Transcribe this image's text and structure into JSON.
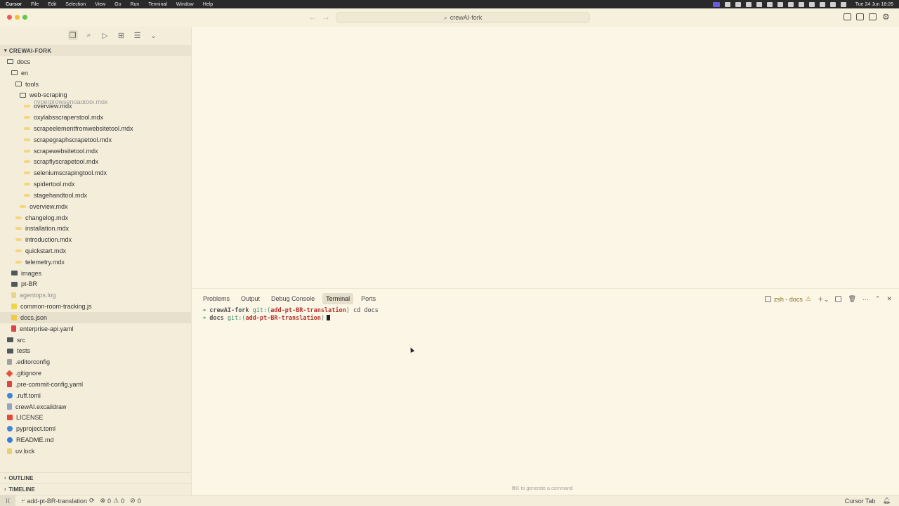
{
  "menubar": {
    "app_name": "Cursor",
    "items": [
      "File",
      "Edit",
      "Selection",
      "View",
      "Go",
      "Run",
      "Terminal",
      "Window",
      "Help"
    ],
    "clock": "Tue 24 Jun  18:26"
  },
  "titlebar": {
    "search_text": "crewAI-fork"
  },
  "sidebar": {
    "explorer_title": "CREWAI-FORK",
    "clipped_entry": "hyperbrowserloadtool.mdx",
    "tree": [
      {
        "label": "docs",
        "icon": "folder-open",
        "indent": 0
      },
      {
        "label": "en",
        "icon": "folder-open",
        "indent": 1
      },
      {
        "label": "tools",
        "icon": "folder-open",
        "indent": 2
      },
      {
        "label": "web-scraping",
        "icon": "folder-open",
        "indent": 3
      },
      {
        "label": "overview.mdx",
        "icon": "mdx",
        "indent": 4
      },
      {
        "label": "oxylabsscraperstool.mdx",
        "icon": "mdx",
        "indent": 4
      },
      {
        "label": "scrapeelementfromwebsitetool.mdx",
        "icon": "mdx",
        "indent": 4
      },
      {
        "label": "scrapegraphscrapetool.mdx",
        "icon": "mdx",
        "indent": 4
      },
      {
        "label": "scrapewebsitetool.mdx",
        "icon": "mdx",
        "indent": 4
      },
      {
        "label": "scrapflyscrapetool.mdx",
        "icon": "mdx",
        "indent": 4
      },
      {
        "label": "seleniumscrapingtool.mdx",
        "icon": "mdx",
        "indent": 4
      },
      {
        "label": "spidertool.mdx",
        "icon": "mdx",
        "indent": 4
      },
      {
        "label": "stagehandtool.mdx",
        "icon": "mdx",
        "indent": 4
      },
      {
        "label": "overview.mdx",
        "icon": "mdx",
        "indent": 3
      },
      {
        "label": "changelog.mdx",
        "icon": "mdx",
        "indent": 2
      },
      {
        "label": "installation.mdx",
        "icon": "mdx",
        "indent": 2
      },
      {
        "label": "introduction.mdx",
        "icon": "mdx",
        "indent": 2
      },
      {
        "label": "quickstart.mdx",
        "icon": "mdx",
        "indent": 2
      },
      {
        "label": "telemetry.mdx",
        "icon": "mdx",
        "indent": 2
      },
      {
        "label": "images",
        "icon": "folder",
        "indent": 1
      },
      {
        "label": "pt-BR",
        "icon": "folder",
        "indent": 1
      },
      {
        "label": "agentops.log",
        "icon": "log",
        "indent": 1,
        "dim": true
      },
      {
        "label": "common-room-tracking.js",
        "icon": "js",
        "indent": 1
      },
      {
        "label": "docs.json",
        "icon": "json",
        "indent": 1,
        "selected": true
      },
      {
        "label": "enterprise-api.yaml",
        "icon": "yaml",
        "indent": 1
      },
      {
        "label": "src",
        "icon": "folder",
        "indent": 0
      },
      {
        "label": "tests",
        "icon": "folder",
        "indent": 0
      },
      {
        "label": ".editorconfig",
        "icon": "editorcfg",
        "indent": 0
      },
      {
        "label": ".gitignore",
        "icon": "git",
        "indent": 0
      },
      {
        "label": ".pre-commit-config.yaml",
        "icon": "yaml",
        "indent": 0
      },
      {
        "label": ".ruff.toml",
        "icon": "gear",
        "indent": 0
      },
      {
        "label": "crewAI.excalidraw",
        "icon": "file",
        "indent": 0
      },
      {
        "label": "LICENSE",
        "icon": "license",
        "indent": 0
      },
      {
        "label": "pyproject.toml",
        "icon": "gear",
        "indent": 0
      },
      {
        "label": "README.md",
        "icon": "info",
        "indent": 0
      },
      {
        "label": "uv.lock",
        "icon": "lock",
        "indent": 0
      }
    ],
    "sections": {
      "outline": "OUTLINE",
      "timeline": "TIMELINE"
    }
  },
  "panel": {
    "tabs": [
      "Problems",
      "Output",
      "Debug Console",
      "Terminal",
      "Ports"
    ],
    "active_tab": "Terminal",
    "terminal_name": "zsh - docs",
    "terminal_lines": [
      {
        "cwd": "crewAI-fork",
        "git": "git:(",
        "branch": "add-pt-BR-translation",
        "close": ")",
        "cmd": " cd docs"
      },
      {
        "cwd": "docs",
        "git": "git:(",
        "branch": "add-pt-BR-translation",
        "close": ")",
        "cmd": ""
      }
    ],
    "hint": "⌘K to generate a command"
  },
  "statusbar": {
    "branch": "add-pt-BR-translation",
    "errors": "0",
    "warnings": "0",
    "ports": "0",
    "right_label": "Cursor Tab"
  },
  "colors": {
    "editor_bg": "#fbf6e6",
    "sidebar_bg": "#f3edda",
    "branch_red": "#b2332c"
  }
}
